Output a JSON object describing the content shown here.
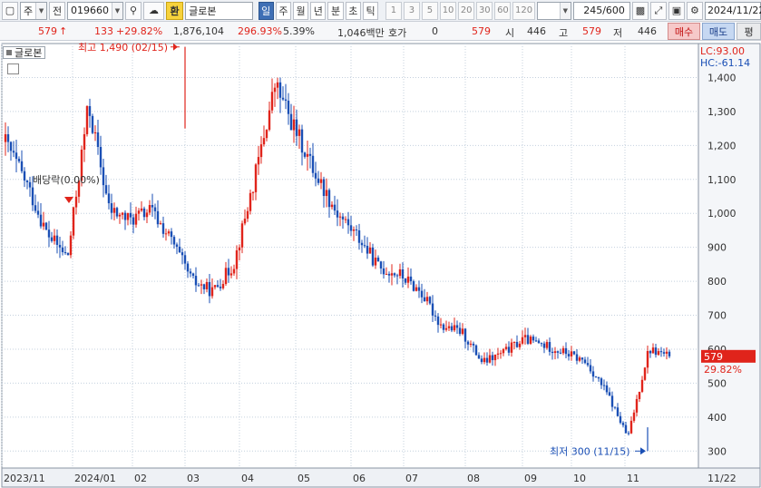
{
  "toolbar": {
    "market_label": "주",
    "prev_label": "전",
    "code": "019660",
    "fx_label": "환",
    "name": "글로본",
    "periods": [
      "일",
      "주",
      "월",
      "년",
      "분",
      "초",
      "틱"
    ],
    "active_period": "일",
    "intervals": [
      "1",
      "3",
      "5",
      "10",
      "20",
      "30",
      "60",
      "120"
    ],
    "count": "245/600",
    "date": "2024/11/22"
  },
  "quote": {
    "price": "579",
    "change_arrow": "↑",
    "change": "133",
    "change_pct": "+29.82%",
    "volume": "1,876,104",
    "volume_ratio": "296.93%",
    "turnover": "5.39%",
    "amount": "1,046백만",
    "hoga_label": "호가",
    "hoga_value": "0",
    "hoga_price": "579",
    "open_label": "시",
    "open": "446",
    "high_label": "고",
    "high": "579",
    "low_label": "저",
    "low": "446",
    "buy_label": "매수",
    "sell_label": "매도",
    "eval_label": "평"
  },
  "chart": {
    "legend_name": "글로본",
    "lc_text": "LC:93.00",
    "hc_text": "HC:-61.14",
    "max_annotation": "최고 1,490 (02/15)",
    "min_annotation": "최저 300 (11/15)",
    "ex_rights_annotation": "배당락(0.00%)",
    "current_price_tag": "579",
    "current_change_tag": "29.82%",
    "colors": {
      "up": "#e0241b",
      "down": "#1a4fb5",
      "grid": "#c4d0de",
      "axis_text": "#333333"
    }
  },
  "chart_data": {
    "type": "candlestick",
    "ylim": [
      250,
      1500
    ],
    "y_ticks": [
      300,
      400,
      500,
      600,
      700,
      800,
      900,
      1000,
      1100,
      1200,
      1300,
      1400
    ],
    "x_labels": [
      "2023/11",
      "2024/01",
      "02",
      "03",
      "04",
      "05",
      "06",
      "07",
      "08",
      "09",
      "10",
      "11",
      "11/22"
    ],
    "close_path": [
      [
        "2023/11 start",
        1210
      ],
      [
        "2023/11 mid",
        1090
      ],
      [
        "2023/11 late",
        940
      ],
      [
        "2023/12 early",
        870
      ],
      [
        "2023/12 spike",
        1320
      ],
      [
        "2023/12 mid",
        1010
      ],
      [
        "2023/12 late",
        980
      ],
      [
        "2024/01 early",
        1010
      ],
      [
        "2024/01 mid",
        920
      ],
      [
        "2024/01 late",
        800
      ],
      [
        "2024/01 end",
        770
      ],
      [
        "2024/02 early",
        850
      ],
      [
        "2024/02 rally",
        1100
      ],
      [
        "2024/02/15",
        1380
      ],
      [
        "2024/02 late",
        1240
      ],
      [
        "2024/03 early",
        1110
      ],
      [
        "2024/03 mid",
        1000
      ],
      [
        "2024/03 late",
        930
      ],
      [
        "2024/04",
        840
      ],
      [
        "2024/05",
        820
      ],
      [
        "2024/06",
        770
      ],
      [
        "2024/07 early",
        670
      ],
      [
        "2024/07 late",
        650
      ],
      [
        "2024/08 early",
        560
      ],
      [
        "2024/08 mid",
        590
      ],
      [
        "2024/08 late",
        630
      ],
      [
        "2024/09",
        610
      ],
      [
        "2024/10 early",
        590
      ],
      [
        "2024/10 late",
        560
      ],
      [
        "2024/11 early",
        470
      ],
      [
        "2024/11/15",
        340
      ],
      [
        "2024/11 spike",
        600
      ],
      [
        "2024/11/22",
        579
      ]
    ],
    "high": 1490,
    "high_date": "02/15",
    "low": 300,
    "low_date": "11/15",
    "last": 579,
    "last_change_pct": 29.82
  }
}
